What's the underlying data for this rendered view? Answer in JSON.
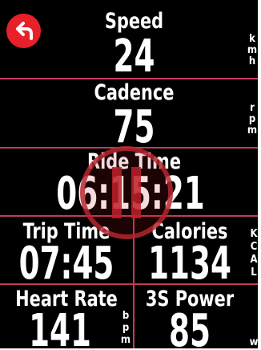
{
  "fields": {
    "speed": {
      "label": "Speed",
      "value": "24",
      "unit": [
        "k",
        "m",
        "h"
      ]
    },
    "cadence": {
      "label": "Cadence",
      "value": "75",
      "unit": [
        "r",
        "p",
        "m"
      ]
    },
    "ride_time": {
      "label": "Ride Time",
      "value": "06:15:21"
    },
    "trip_time": {
      "label": "Trip Time",
      "value": "07:45"
    },
    "calories": {
      "label": "Calories",
      "value": "1134",
      "unit": [
        "K",
        "C",
        "A",
        "L"
      ]
    },
    "heart_rate": {
      "label": "Heart Rate",
      "value": "141",
      "unit": [
        "b",
        "p",
        "m"
      ]
    },
    "power_3s": {
      "label": "3S Power",
      "value": "85",
      "unit": [
        "w"
      ]
    }
  },
  "controls": {
    "back_icon": "back-arrow-icon",
    "pause_icon": "pause-icon"
  },
  "colors": {
    "background": "#000000",
    "text": "#ffffff",
    "divider": "#c7385d",
    "back_button": "#e8202a",
    "pause_overlay": "#c0202a"
  }
}
